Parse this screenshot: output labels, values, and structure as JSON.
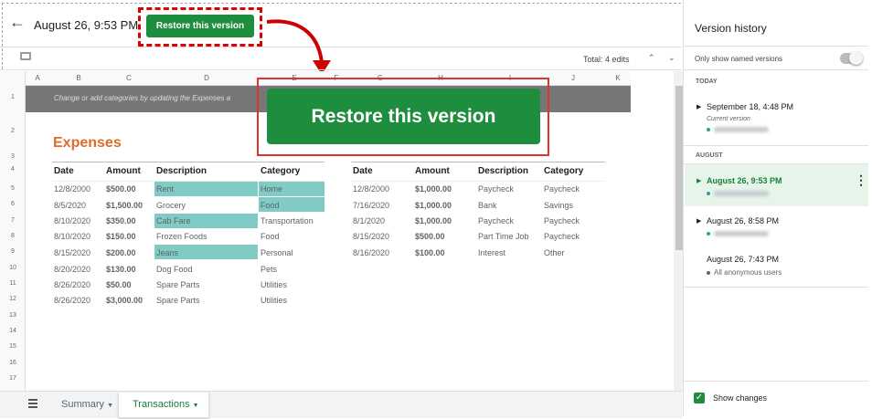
{
  "header": {
    "title": "August 26, 9:53 PM",
    "restore_label": "Restore this version",
    "total_edits": "Total: 4 edits"
  },
  "columns": [
    "A",
    "B",
    "C",
    "D",
    "E",
    "F",
    "G",
    "H",
    "I",
    "J",
    "K"
  ],
  "rows": [
    "1",
    "2",
    "3",
    "4",
    "5",
    "6",
    "7",
    "8",
    "9",
    "10",
    "11",
    "12",
    "13",
    "14",
    "15",
    "16",
    "17"
  ],
  "banner": "Change or add categories by updating the Expenses a",
  "callout": {
    "label": "Restore this version"
  },
  "expenses": {
    "title": "Expenses",
    "headers": [
      "Date",
      "Amount",
      "Description",
      "Category"
    ],
    "rows": [
      [
        "12/8/2000",
        "$500.00",
        "Rent",
        "Home"
      ],
      [
        "8/5/2020",
        "$1,500.00",
        "Grocery",
        "Food"
      ],
      [
        "8/10/2020",
        "$350.00",
        "Cab Fare",
        "Transportation"
      ],
      [
        "8/10/2020",
        "$150.00",
        "Frozen Foods",
        "Food"
      ],
      [
        "8/15/2020",
        "$200.00",
        "Jeans",
        "Personal"
      ],
      [
        "8/20/2020",
        "$130.00",
        "Dog Food",
        "Pets"
      ],
      [
        "8/26/2020",
        "$50.00",
        "Spare Parts",
        "Utilities"
      ],
      [
        "8/26/2020",
        "$3,000.00",
        "Spare Parts",
        "Utilities"
      ]
    ]
  },
  "income": {
    "headers": [
      "Date",
      "Amount",
      "Description",
      "Category"
    ],
    "rows": [
      [
        "12/8/2000",
        "$1,000.00",
        "Paycheck",
        "Paycheck"
      ],
      [
        "7/16/2020",
        "$1,000.00",
        "Bank",
        "Savings"
      ],
      [
        "8/1/2020",
        "$1,000.00",
        "Paycheck",
        "Paycheck"
      ],
      [
        "8/15/2020",
        "$500.00",
        "Part Time Job",
        "Paycheck"
      ],
      [
        "8/16/2020",
        "$100.00",
        "Interest",
        "Other"
      ]
    ]
  },
  "tabs": {
    "summary": "Summary",
    "transactions": "Transactions"
  },
  "sidebar": {
    "title": "Version history",
    "named_only": "Only show named versions",
    "today": "TODAY",
    "august": "AUGUST",
    "v1_time": "September 18, 4:48 PM",
    "v1_sub": "Current version",
    "v2_time": "August 26, 9:53 PM",
    "v3_time": "August 26, 8:58 PM",
    "v4_time": "August 26, 7:43 PM",
    "v4_user": "All anonymous users",
    "show_changes": "Show changes"
  },
  "colors": {
    "accent": "#1e8e3e",
    "orange": "#e06b2a",
    "highlight": "#80cbc4",
    "callout_red": "#d00"
  }
}
